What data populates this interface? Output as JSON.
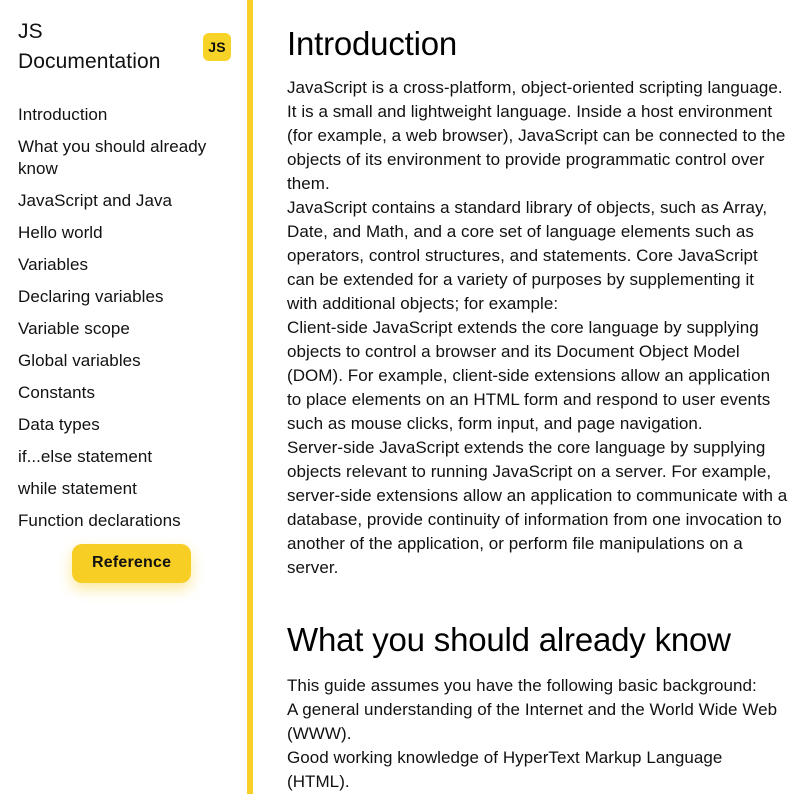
{
  "sidebar": {
    "brand_title": "JS Documentation",
    "badge_label": "JS",
    "nav_items": [
      {
        "label": "Introduction"
      },
      {
        "label": "What you should already know"
      },
      {
        "label": "JavaScript and Java"
      },
      {
        "label": "Hello world"
      },
      {
        "label": "Variables"
      },
      {
        "label": "Declaring variables"
      },
      {
        "label": "Variable scope"
      },
      {
        "label": "Global variables"
      },
      {
        "label": "Constants"
      },
      {
        "label": "Data types"
      },
      {
        "label": "if...else statement"
      },
      {
        "label": "while statement"
      },
      {
        "label": "Function declarations"
      }
    ],
    "reference_button_label": "Reference"
  },
  "content": {
    "sections": [
      {
        "heading": "Introduction",
        "paragraphs": [
          "JavaScript is a cross-platform, object-oriented scripting language. It is a small and lightweight language. Inside a host environment (for example, a web browser), JavaScript can be connected to the objects of its environment to provide programmatic control over them.",
          "JavaScript contains a standard library of objects, such as Array, Date, and Math, and a core set of language elements such as operators, control structures, and statements. Core JavaScript can be extended for a variety of purposes by supplementing it with additional objects; for example:",
          "Client-side JavaScript extends the core language by supplying objects to control a browser and its Document Object Model (DOM). For example, client-side extensions allow an application to place elements on an HTML form and respond to user events such as mouse clicks, form input, and page navigation.",
          "Server-side JavaScript extends the core language by supplying objects relevant to running JavaScript on a server. For example, server-side extensions allow an application to communicate with a database, provide continuity of information from one invocation to another of the application, or perform file manipulations on a server."
        ]
      },
      {
        "heading": "What you should already know",
        "paragraphs": [
          "This guide assumes you have the following basic background:",
          "A general understanding of the Internet and the World Wide Web (WWW).",
          "Good working knowledge of HyperText Markup Language (HTML)."
        ]
      }
    ]
  },
  "colors": {
    "accent": "#F7CF26",
    "badge": "#F7D227",
    "text": "#111111",
    "background": "#FFFFFF"
  }
}
